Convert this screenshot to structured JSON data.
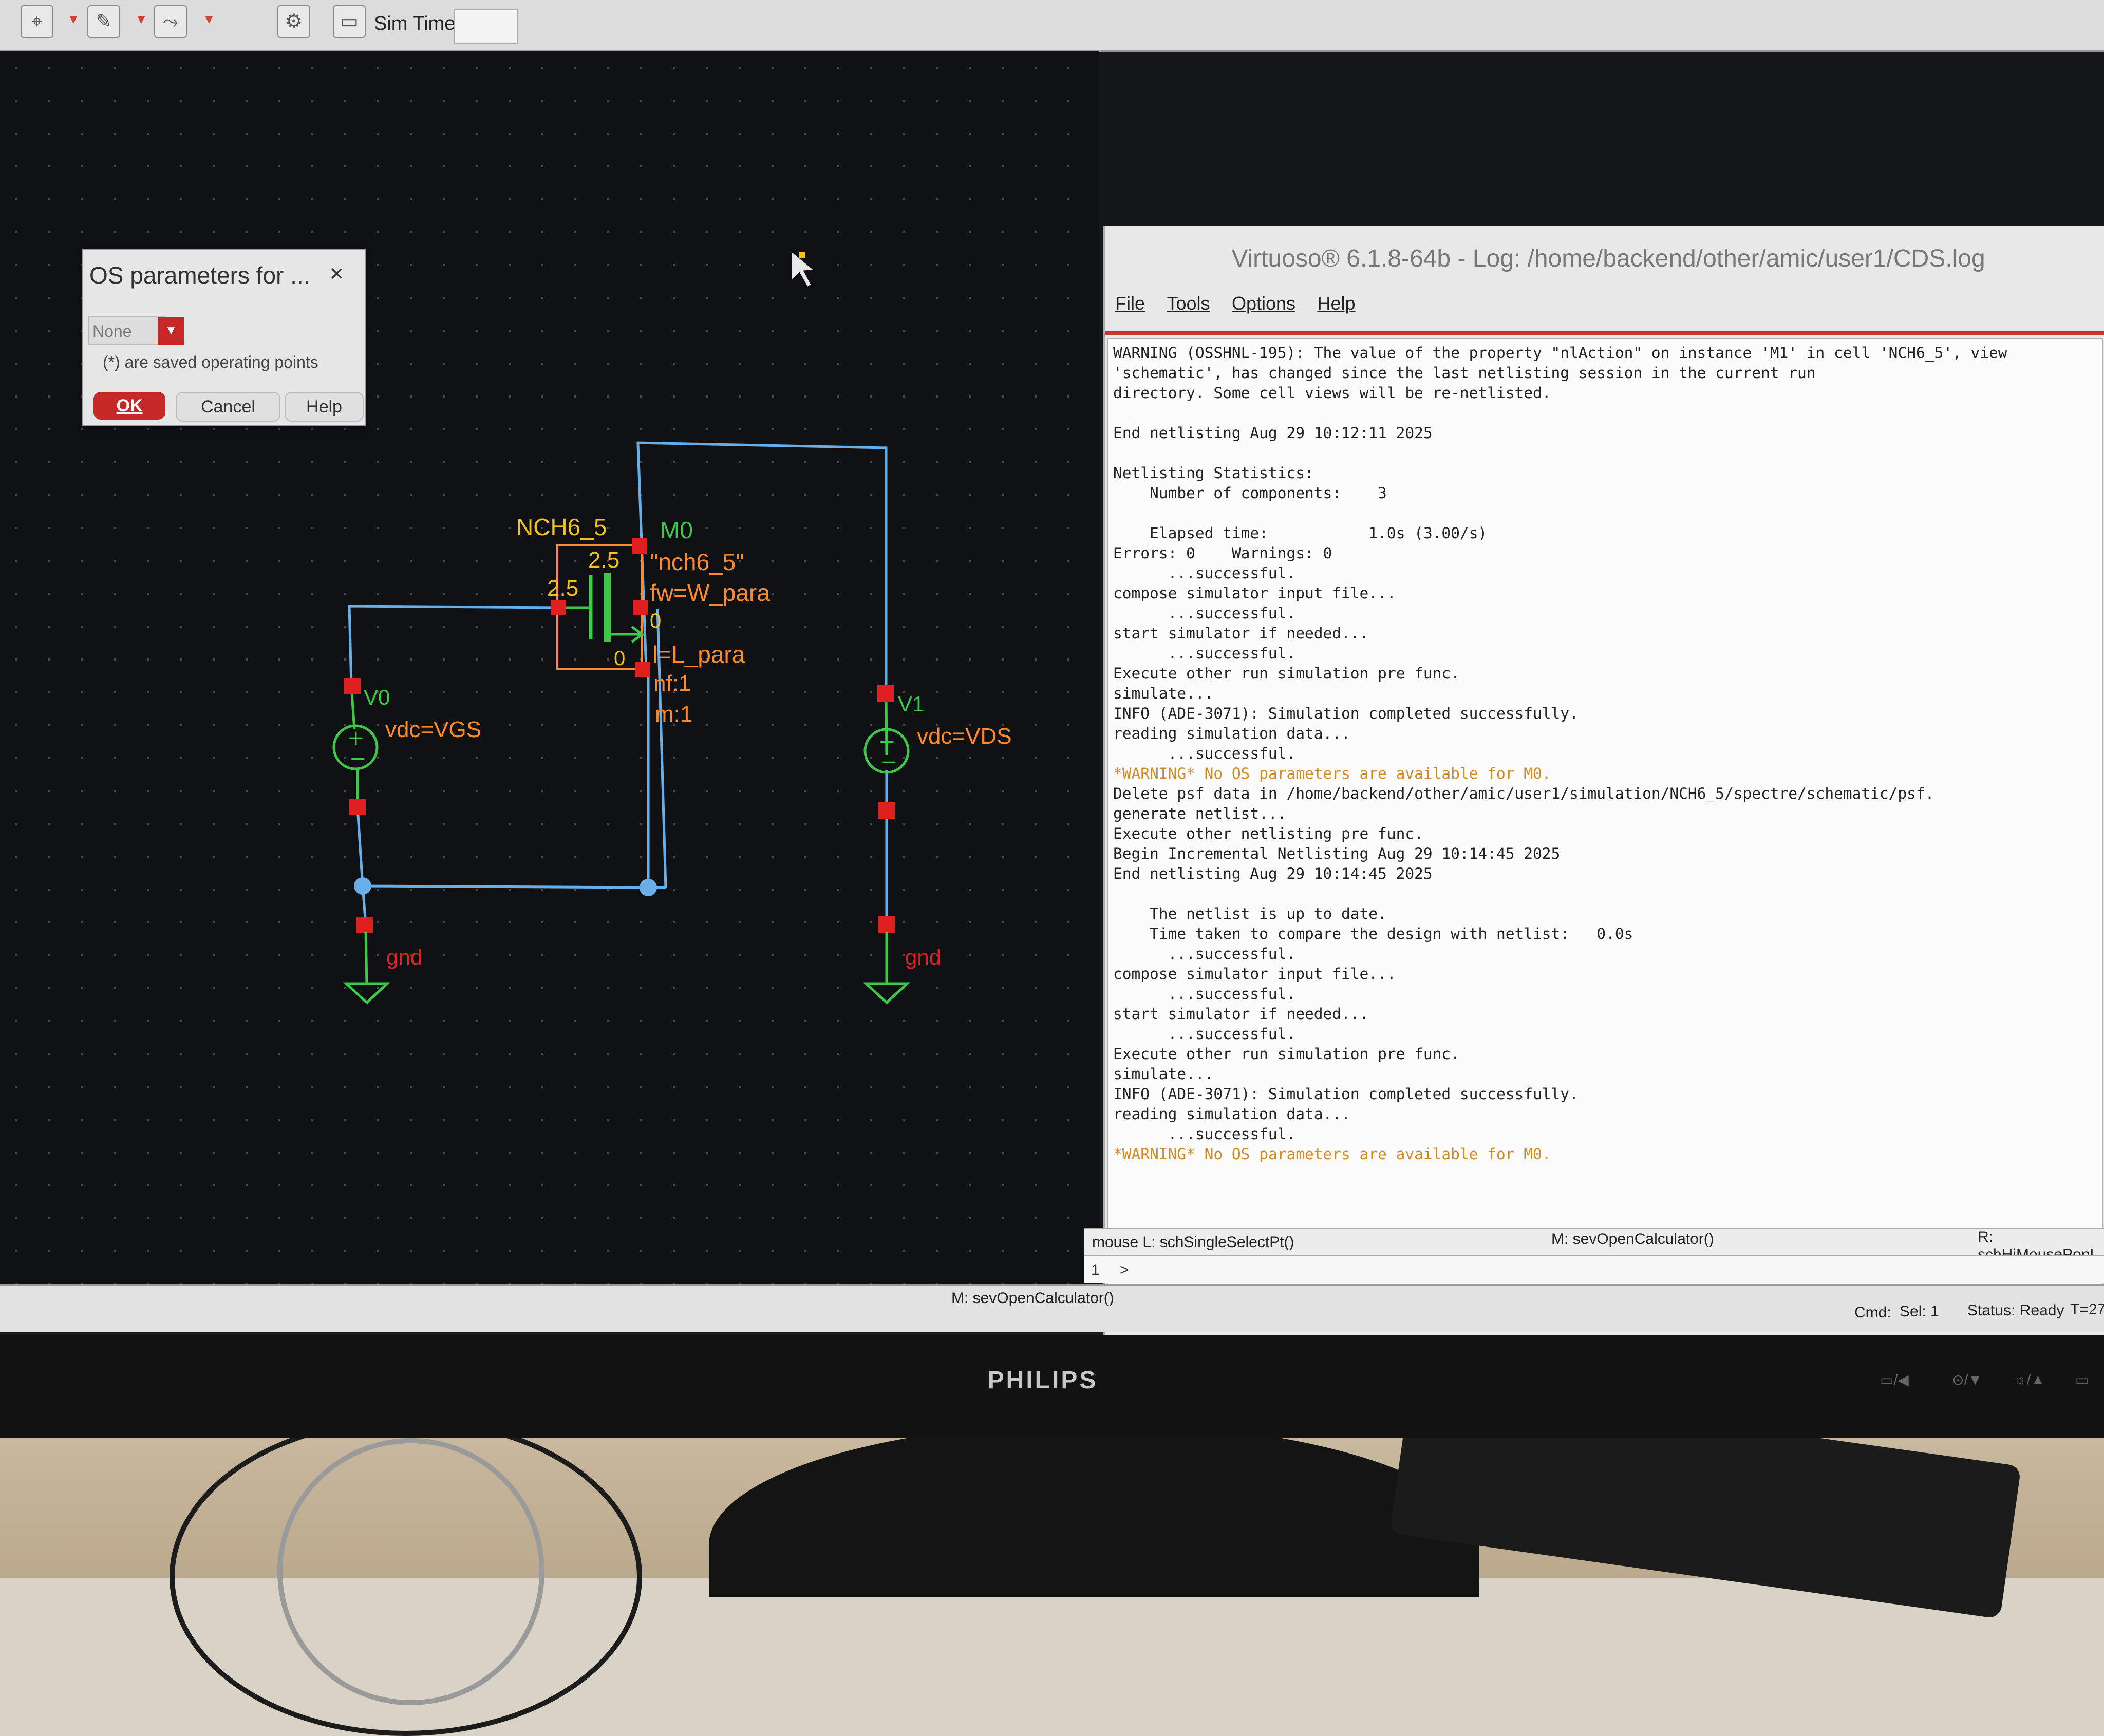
{
  "toolbar": {
    "sim_time_label": "Sim Time",
    "sim_time_value": ""
  },
  "dialog": {
    "title": "OS parameters for ...",
    "close": "×",
    "select_value": "None",
    "note": "(*) are saved operating points",
    "ok": "OK",
    "cancel": "Cancel",
    "help": "Help"
  },
  "schematic": {
    "cell_name": "NCH6_5",
    "instance_name": "M0",
    "model": "\"nch6_5\"",
    "fw": "fw=W_para",
    "l": "l=L_para",
    "nf": "nf:1",
    "m": "m:1",
    "pin_top": "2.5",
    "pin_left": "2.5",
    "pin_bulk": "0",
    "pin_bottom": "0",
    "v0_name": "V0",
    "v0_value": "vdc=VGS",
    "v1_name": "V1",
    "v1_value": "vdc=VDS",
    "gnd_left": "gnd",
    "gnd_right": "gnd"
  },
  "log": {
    "title": "Virtuoso® 6.1.8-64b - Log: /home/backend/other/amic/user1/CDS.log",
    "menu": [
      "File",
      "Tools",
      "Options",
      "Help"
    ],
    "lines": [
      "WARNING (OSSHNL-195): The value of the property \"nlAction\" on instance 'M1' in cell 'NCH6_5', view",
      "'schematic', has changed since the last netlisting session in the current run",
      "directory. Some cell views will be re-netlisted.",
      "",
      "End netlisting Aug 29 10:12:11 2025",
      "",
      "Netlisting Statistics:",
      "    Number of components:    3",
      "",
      "    Elapsed time:           1.0s (3.00/s)",
      "Errors: 0    Warnings: 0",
      "      ...successful.",
      "compose simulator input file...",
      "      ...successful.",
      "start simulator if needed...",
      "      ...successful.",
      "Execute other run simulation pre func.",
      "simulate...",
      "INFO (ADE-3071): Simulation completed successfully.",
      "reading simulation data...",
      "      ...successful.",
      "*WARNING* No OS parameters are available for M0.",
      "Delete psf data in /home/backend/other/amic/user1/simulation/NCH6_5/spectre/schematic/psf.",
      "generate netlist...",
      "Execute other netlisting pre func.",
      "Begin Incremental Netlisting Aug 29 10:14:45 2025",
      "End netlisting Aug 29 10:14:45 2025",
      "",
      "    The netlist is up to date.",
      "    Time taken to compare the design with netlist:   0.0s",
      "      ...successful.",
      "compose simulator input file...",
      "      ...successful.",
      "start simulator if needed...",
      "      ...successful.",
      "Execute other run simulation pre func.",
      "simulate...",
      "INFO (ADE-3071): Simulation completed successfully.",
      "reading simulation data...",
      "      ...successful.",
      "*WARNING* No OS parameters are available for M0."
    ],
    "mouse_left": "mouse L: schSingleSelectPt()",
    "mouse_middle": "M: sevOpenCalculator()",
    "mouse_right": "R: schHiMousePopL",
    "cmd_num": "1",
    "cmd_prompt": ">"
  },
  "status": {
    "middle": "M: sevOpenCalculator()",
    "cmd": "Cmd:",
    "sel": "Sel: 1",
    "status": "Status: Ready",
    "t": "T=27"
  },
  "monitor": {
    "brand": "PHILIPS"
  },
  "colors": {
    "wire": "#6aaee8",
    "pin": "#e02020",
    "label_orange": "#ff8a2a",
    "label_yellow": "#f2c21a",
    "label_green": "#3ec84a",
    "accent_red": "#c62828"
  }
}
